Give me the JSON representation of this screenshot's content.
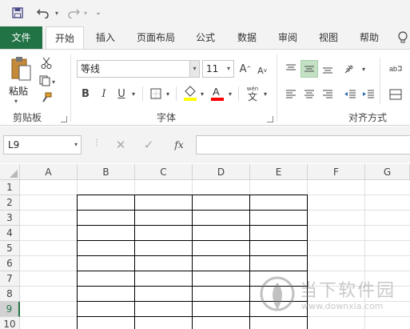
{
  "qat": {
    "save": "save-icon",
    "undo": "undo-icon",
    "redo": "redo-icon"
  },
  "tabs": [
    {
      "label": "文件"
    },
    {
      "label": "开始"
    },
    {
      "label": "插入"
    },
    {
      "label": "页面布局"
    },
    {
      "label": "公式"
    },
    {
      "label": "数据"
    },
    {
      "label": "审阅"
    },
    {
      "label": "视图"
    },
    {
      "label": "帮助"
    }
  ],
  "ribbon": {
    "clipboard": {
      "paste_label": "粘贴",
      "group_label": "剪贴板"
    },
    "font": {
      "name": "等线",
      "size": "11",
      "group_label": "字体",
      "bold": "B",
      "italic": "I",
      "underline": "U",
      "grow": "A",
      "shrink": "A",
      "phonetic": "wén",
      "phonetic_char": "文"
    },
    "alignment": {
      "group_label": "对齐方式"
    }
  },
  "formula_bar": {
    "name_box": "L9",
    "fx": "fx",
    "value": ""
  },
  "columns": [
    "A",
    "B",
    "C",
    "D",
    "E",
    "F",
    "G"
  ],
  "rows": [
    "1",
    "2",
    "3",
    "4",
    "5",
    "6",
    "7",
    "8",
    "9",
    "10"
  ],
  "selected_row": "9",
  "watermark": {
    "title": "当下软件园",
    "url": "www.downxia.com"
  },
  "colors": {
    "accent": "#217346"
  }
}
